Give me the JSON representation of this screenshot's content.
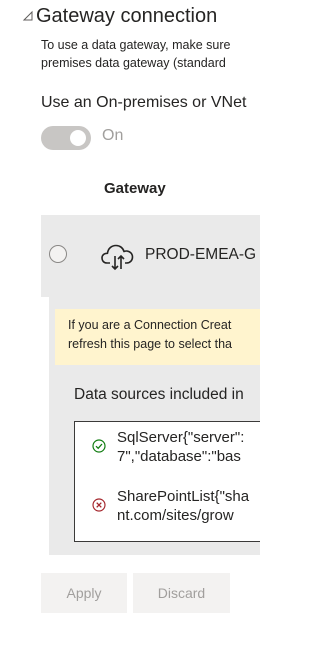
{
  "section": {
    "title": "Gateway connection",
    "collapse_icon": "triangle-collapse-icon"
  },
  "description": {
    "line1": "To use a data gateway, make sure",
    "line2": "premises data gateway (standard"
  },
  "on_premises_toggle": {
    "label": "Use an On-premises or VNet",
    "state": "On",
    "enabled": false
  },
  "gateways": {
    "column_header": "Gateway",
    "rows": [
      {
        "name": "PROD-EMEA-G",
        "icon": "cloud-gateway-icon",
        "selected": false
      }
    ]
  },
  "details": {
    "info_banner": {
      "line1": "If you are a Connection Creat",
      "line2": "refresh this page to select tha"
    },
    "data_sources_heading": "Data sources included in",
    "data_sources": [
      {
        "status": "success",
        "icon": "check-circle-icon",
        "line1": "SqlServer{\"server\":",
        "line2": "7\",\"database\":\"bas"
      },
      {
        "status": "error",
        "icon": "error-circle-icon",
        "line1": "SharePointList{\"sha",
        "line2": "nt.com/sites/grow"
      }
    ]
  },
  "buttons": {
    "apply": "Apply",
    "discard": "Discard"
  },
  "colors": {
    "accent_success": "#107c10",
    "accent_error": "#a4262c",
    "banner": "#fff4ce",
    "disabled_text": "#a19f9d"
  }
}
